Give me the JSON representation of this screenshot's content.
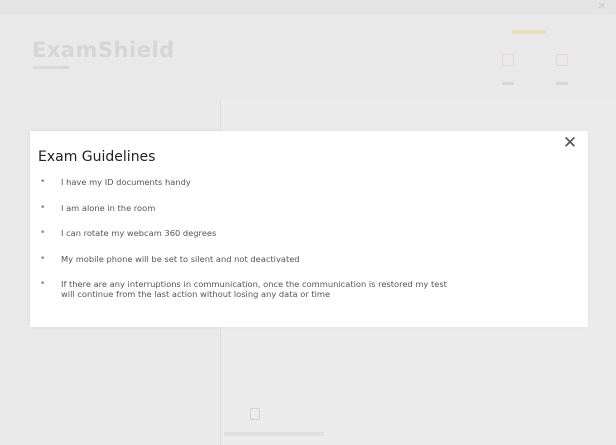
{
  "window": {
    "close_glyph": "✕"
  },
  "app": {
    "brand_name": "ExamShield"
  },
  "modal": {
    "title": "Exam Guidelines",
    "close_glyph": "✕",
    "items": [
      {
        "line1": "I have my ID documents handy",
        "line2": ""
      },
      {
        "line1": "I am alone in the room",
        "line2": ""
      },
      {
        "line1": "I can rotate my webcam 360 degrees",
        "line2": ""
      },
      {
        "line1": "My mobile phone will be set to silent and not deactivated",
        "line2": ""
      },
      {
        "line1": "If there are any interruptions in communication, once the communication is restored my test",
        "line2": "will continue from the last action without losing any data or time"
      }
    ]
  },
  "icons": {
    "window_close": "close-icon",
    "modal_close": "close-icon",
    "bullet": "bullet-dot"
  },
  "colors": {
    "background_overlay": "#e9e9e9",
    "modal_background": "#ffffff",
    "title_text": "#222222",
    "body_text": "#555555"
  }
}
